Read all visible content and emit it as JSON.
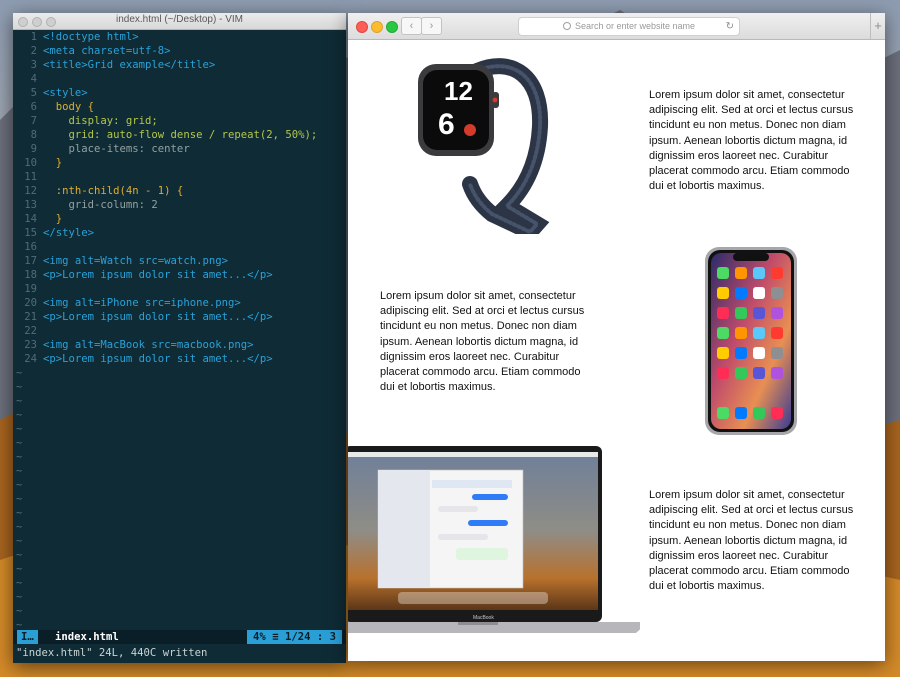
{
  "vim": {
    "title": "index.html (~/Desktop) - VIM",
    "lines": [
      {
        "n": "1",
        "t": "<!doctype html>"
      },
      {
        "n": "2",
        "t": "<meta charset=utf-8>"
      },
      {
        "n": "3",
        "t": "<title>Grid example</title>"
      },
      {
        "n": "4",
        "t": ""
      },
      {
        "n": "5",
        "t": "<style>"
      },
      {
        "n": "6",
        "t": "  body {"
      },
      {
        "n": "7",
        "t": "    display: grid;"
      },
      {
        "n": "8",
        "t": "    grid: auto-flow dense / repeat(2, 50%);"
      },
      {
        "n": "9",
        "t": "    place-items: center"
      },
      {
        "n": "10",
        "t": "  }"
      },
      {
        "n": "11",
        "t": ""
      },
      {
        "n": "12",
        "t": "  :nth-child(4n - 1) {"
      },
      {
        "n": "13",
        "t": "    grid-column: 2"
      },
      {
        "n": "14",
        "t": "  }"
      },
      {
        "n": "15",
        "t": "</style>"
      },
      {
        "n": "16",
        "t": ""
      },
      {
        "n": "17",
        "t": "<img alt=Watch src=watch.png>"
      },
      {
        "n": "18",
        "t": "<p>Lorem ipsum dolor sit amet...</p>"
      },
      {
        "n": "19",
        "t": ""
      },
      {
        "n": "20",
        "t": "<img alt=iPhone src=iphone.png>"
      },
      {
        "n": "21",
        "t": "<p>Lorem ipsum dolor sit amet...</p>"
      },
      {
        "n": "22",
        "t": ""
      },
      {
        "n": "23",
        "t": "<img alt=MacBook src=macbook.png>"
      },
      {
        "n": "24",
        "t": "<p>Lorem ipsum dolor sit amet...</p>"
      }
    ],
    "tilde": "~",
    "status": {
      "mode": "I…",
      "file": "index.html",
      "percent": "4%",
      "position": "1/24",
      "column": "3"
    },
    "cmdline": "\"index.html\" 24L, 440C written"
  },
  "safari": {
    "search_placeholder": "Search or enter website name",
    "paragraph": "Lorem ipsum dolor sit amet, consectetur adipiscing elit. Sed at orci et lectus cursus tincidunt eu non metus. Donec non diam ipsum. Aenean lobortis dictum magna, id dignissim eros laoreet nec. Curabitur placerat commodo arcu. Etiam commodo dui et lobortis maximus.",
    "images": {
      "watch": "Watch",
      "iphone": "iPhone",
      "macbook": "MacBook"
    },
    "watch_time": "12",
    "watch_date": "6",
    "macbook_label": "MacBook"
  },
  "colors": {
    "vim_bg": "#0f2b35",
    "accent": "#2a9fd6"
  }
}
